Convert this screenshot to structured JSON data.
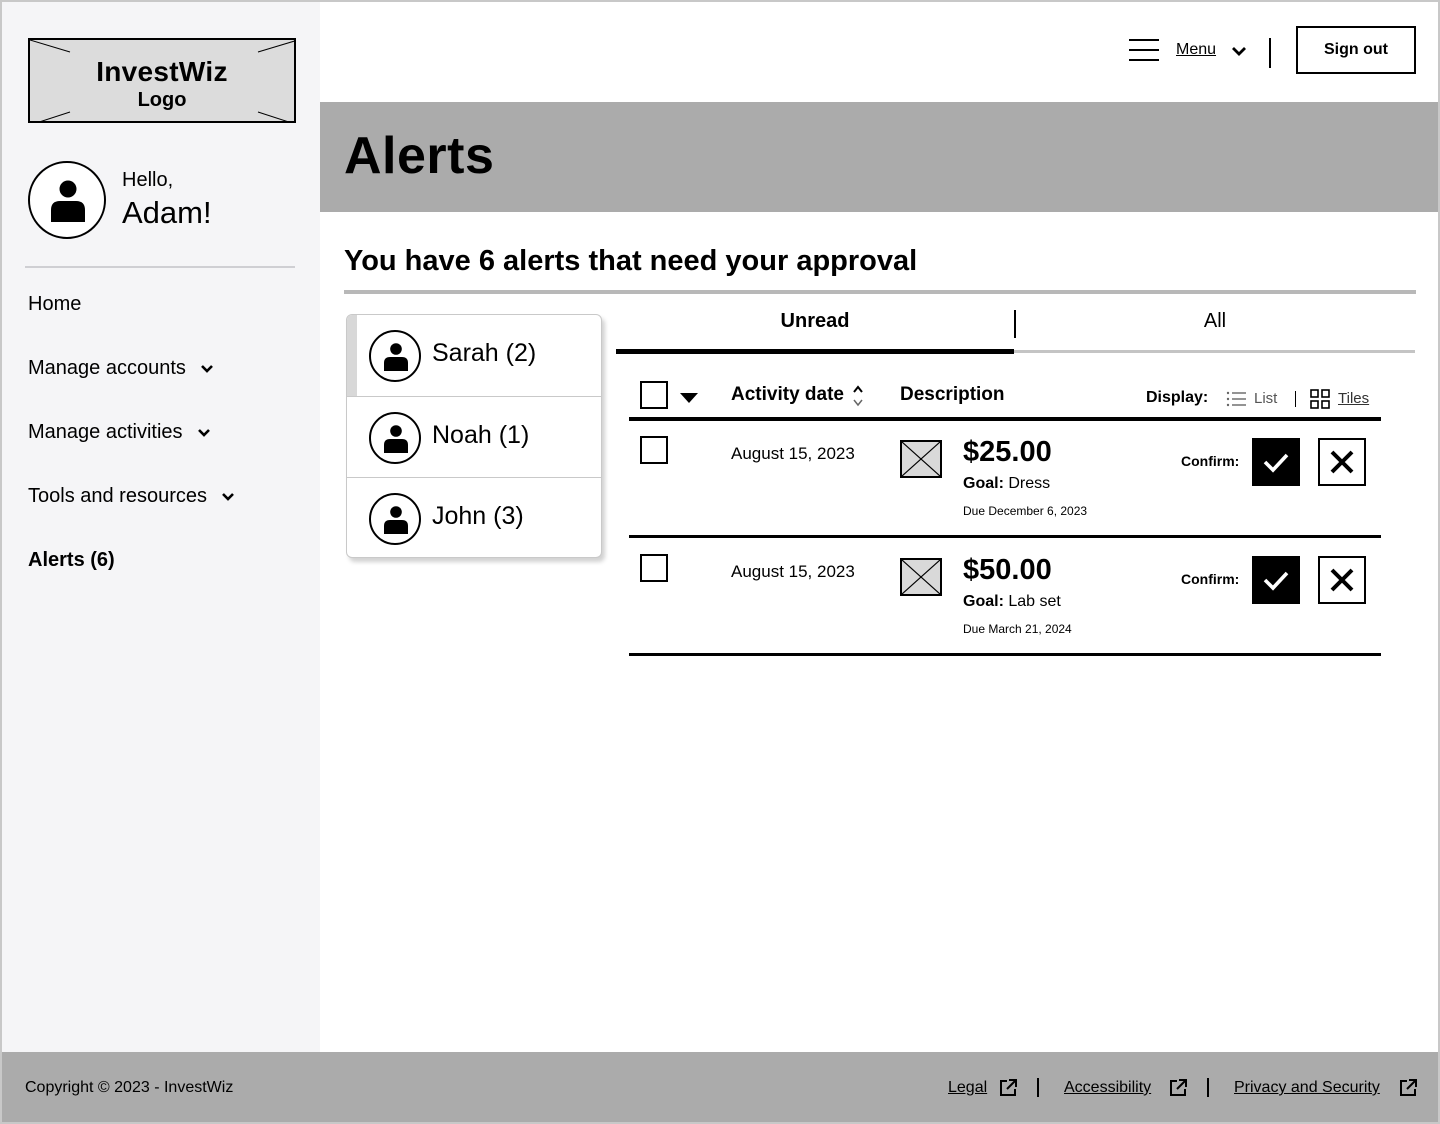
{
  "sidebar": {
    "logo": {
      "title": "InvestWiz",
      "subtitle": "Logo"
    },
    "greeting": "Hello,",
    "user_name": "Adam!",
    "nav": [
      {
        "label": "Home"
      },
      {
        "label": "Manage accounts"
      },
      {
        "label": "Manage activities"
      },
      {
        "label": "Tools and resources"
      },
      {
        "label": "Alerts (6)"
      }
    ]
  },
  "header": {
    "menu_label": "Menu",
    "signout_label": "Sign out"
  },
  "page": {
    "title": "Alerts",
    "heading": "You have 6 alerts that need your approval"
  },
  "people": [
    {
      "name": "Sarah (2)",
      "selected": true
    },
    {
      "name": "Noah (1)",
      "selected": false
    },
    {
      "name": "John (3)",
      "selected": false
    }
  ],
  "tabs": [
    {
      "label": "Unread",
      "active": true
    },
    {
      "label": "All",
      "active": false
    }
  ],
  "table": {
    "columns": {
      "date": "Activity date",
      "description": "Description"
    },
    "display_label": "Display:",
    "display_options": {
      "list": "List",
      "tiles": "Tiles"
    },
    "confirm_label": "Confirm:",
    "rows": [
      {
        "date": "August 15, 2023",
        "amount": "$25.00",
        "goal_label": "Goal:",
        "goal": "Dress",
        "due": "Due December 6, 2023"
      },
      {
        "date": "August 15, 2023",
        "amount": "$50.00",
        "goal_label": "Goal:",
        "goal": "Lab set",
        "due": "Due March 21, 2024"
      }
    ]
  },
  "footer": {
    "copyright": "Copyright © 2023 - InvestWiz",
    "links": [
      {
        "label": "Legal"
      },
      {
        "label": "Accessibility"
      },
      {
        "label": "Privacy and Security"
      }
    ]
  },
  "colors": {
    "banner": "#ababab",
    "sidebar_bg": "#f5f5f7",
    "footer": "#ababab",
    "accent": "#000000"
  },
  "icons": {
    "menu": "hamburger-icon",
    "dropdown": "chevron-down-icon",
    "user": "person-icon",
    "sort": "sort-icon",
    "list": "list-view-icon",
    "tiles": "grid-view-icon",
    "approve": "check-icon",
    "reject": "close-icon",
    "image": "image-placeholder-icon",
    "external": "external-link-icon"
  }
}
